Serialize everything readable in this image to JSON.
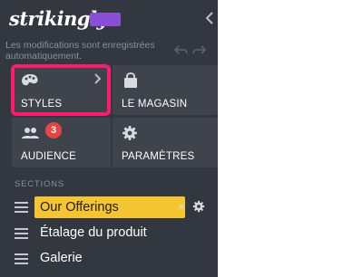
{
  "header": {
    "brand": "strikingly",
    "autosave_note": "Les modifications sont enregistrées automatiquement."
  },
  "tiles": [
    {
      "label": "STYLES",
      "icon": "palette-icon"
    },
    {
      "label": "LE MAGASIN",
      "icon": "shopping-bag-icon"
    },
    {
      "label": "AUDIENCE",
      "icon": "people-icon",
      "badge": "3"
    },
    {
      "label": "PARAMÈTRES",
      "icon": "gear-icon"
    }
  ],
  "sections": {
    "title": "SECTIONS",
    "items": [
      {
        "label": "Our Offerings",
        "active": true
      },
      {
        "label": "Étalage du produit"
      },
      {
        "label": "Galerie"
      }
    ]
  },
  "colors": {
    "sidebar_bg": "#33373f",
    "tile_bg": "#3e434c",
    "highlight": "#ff1c6e",
    "active_section": "#f4c531",
    "badge": "#e84444",
    "brand_badge": "#8a4fd6"
  }
}
